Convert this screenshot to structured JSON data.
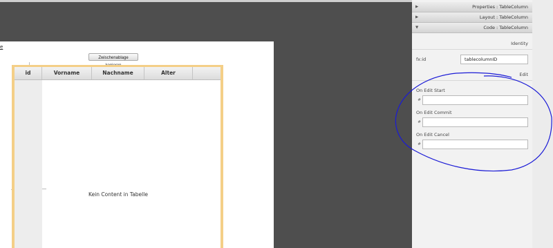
{
  "editor": {
    "stub_link_text": "e",
    "copy_button_label": "Zwischenablage kopieren",
    "table": {
      "columns": [
        "id",
        "Vorname",
        "Nachname",
        "Alter"
      ],
      "placeholder": "Kein Content in Tabelle"
    }
  },
  "inspector": {
    "sections": [
      {
        "label": "Properties : TableColumn",
        "expanded": false
      },
      {
        "label": "Layout : TableColumn",
        "expanded": false
      },
      {
        "label": "Code : TableColumn",
        "expanded": true
      }
    ],
    "identity": {
      "title": "Identity",
      "fxid_label": "fx:id",
      "fxid_value": "tablecolumnID"
    },
    "edit": {
      "title": "Edit",
      "fields": [
        {
          "label": "On Edit Start",
          "prefix": "#",
          "value": ""
        },
        {
          "label": "On Edit Commit",
          "prefix": "#",
          "value": ""
        },
        {
          "label": "On Edit Cancel",
          "prefix": "#",
          "value": ""
        }
      ]
    }
  },
  "annotation_color": "#1a1ad6"
}
